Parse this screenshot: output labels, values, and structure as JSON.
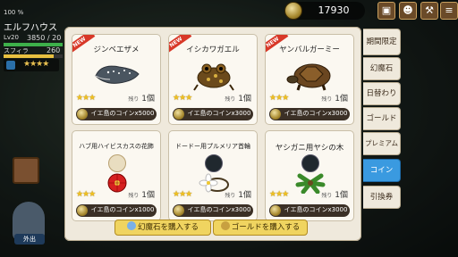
{
  "player": {
    "hp_percent": "100 %",
    "name": "エルフハウス",
    "level": "Lv20",
    "hp_text": "3850 / 20",
    "hp_fraction": 1.0,
    "stamina_label": "スフィラ",
    "stamina_value": "260",
    "stamina_fraction": 0.85,
    "rank_stars": "★★★★"
  },
  "header": {
    "coin_amount": "17930"
  },
  "items": [
    {
      "name": "ジンベエザメ",
      "is_new": true,
      "new_label": "NEW",
      "stars": "★★★",
      "stock_label": "残り",
      "stock": "1個",
      "price": "イエ島のコインx5000",
      "icon": "whale-shark-image"
    },
    {
      "name": "イシカワガエル",
      "is_new": true,
      "new_label": "NEW",
      "stars": "★★★",
      "stock_label": "残り",
      "stock": "1個",
      "price": "イエ島のコインx3000",
      "icon": "frog-image"
    },
    {
      "name": "ヤンバルガーミー",
      "is_new": true,
      "new_label": "NEW",
      "stars": "★★★",
      "stock_label": "残り",
      "stock": "1個",
      "price": "イエ島のコインx3000",
      "icon": "turtle-image"
    },
    {
      "name": "ハブ用ハイビスカスの花飾",
      "is_new": false,
      "stars": "★★★",
      "stock_label": "残り",
      "stock": "1個",
      "price": "イエ島のコインx1000",
      "icon": "hibiscus-image"
    },
    {
      "name": "ドードー用プルメリア首輪",
      "is_new": false,
      "stars": "★★★",
      "stock_label": "残り",
      "stock": "1個",
      "price": "イエ島のコインx3000",
      "icon": "plumeria-collar-image"
    },
    {
      "name": "ヤシガニ用ヤシの木",
      "is_new": false,
      "stars": "★★★",
      "stock_label": "残り",
      "stock": "1個",
      "price": "イエ島のコインx3000",
      "icon": "palm-tree-image"
    }
  ],
  "buttons": {
    "buy_gems": "幻魔石を購入する",
    "buy_gold": "ゴールドを購入する"
  },
  "tabs": [
    {
      "label": "期間限定",
      "active": false
    },
    {
      "label": "幻魔石",
      "active": false
    },
    {
      "label": "日替わり",
      "active": false
    },
    {
      "label": "ゴールド",
      "active": false
    },
    {
      "label": "プレミアム",
      "active": false
    },
    {
      "label": "コイン",
      "active": true
    },
    {
      "label": "引換券",
      "active": false
    }
  ],
  "left": {
    "outside_label": "外出"
  },
  "colors": {
    "active_tab": "#3a9ae0",
    "new_badge": "#d83828",
    "star": "#f0c020",
    "hp_bar": "#3db04a",
    "stamina_bar": "#e8c040"
  }
}
